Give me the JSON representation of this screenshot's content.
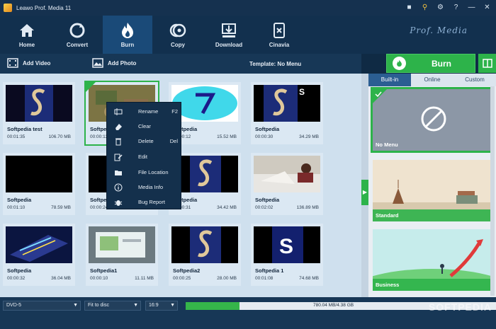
{
  "app": {
    "title": "Leawo Prof. Media 11",
    "brand": "Prof. Media",
    "title_icons": [
      "chat-icon",
      "key-icon",
      "gear-icon",
      "help-icon",
      "minimize-icon",
      "close-icon"
    ]
  },
  "nav": {
    "tabs": [
      {
        "label": "Home",
        "icon": "home-icon",
        "active": false
      },
      {
        "label": "Convert",
        "icon": "convert-icon",
        "active": false
      },
      {
        "label": "Burn",
        "icon": "flame-icon",
        "active": true
      },
      {
        "label": "Copy",
        "icon": "disc-copy-icon",
        "active": false
      },
      {
        "label": "Download",
        "icon": "download-icon",
        "active": false
      },
      {
        "label": "Cinavia",
        "icon": "cinavia-icon",
        "active": false
      }
    ]
  },
  "toolbar": {
    "add_video": "Add Video",
    "add_photo": "Add Photo",
    "template_label": "Template: No Menu",
    "burn_label": "Burn"
  },
  "videos": [
    {
      "name": "Softpedia test",
      "duration": "00:01:35",
      "size": "106.70 MB",
      "thumb": "softpedia-s"
    },
    {
      "name": "Softpedia",
      "duration": "00:00:13",
      "size": "",
      "thumb": "photo-ground",
      "selected": true
    },
    {
      "name": "Softpedia",
      "duration": "00:00:12",
      "size": "15.52 MB",
      "thumb": "number-7"
    },
    {
      "name": "Softpedia",
      "duration": "00:00:30",
      "size": "34.29 MB",
      "thumb": "softpedia-s"
    },
    {
      "name": "Softpedia",
      "duration": "00:01:10",
      "size": "78.59 MB",
      "thumb": "black"
    },
    {
      "name": "Softpedia",
      "duration": "00:00:24",
      "size": "",
      "thumb": "black"
    },
    {
      "name": "Softpedia",
      "duration": "00:00:31",
      "size": "34.42 MB",
      "thumb": "softpedia-s"
    },
    {
      "name": "Softpedia",
      "duration": "00:02:02",
      "size": "136.89 MB",
      "thumb": "photo-room"
    },
    {
      "name": "Softpedia",
      "duration": "00:00:32",
      "size": "36.04 MB",
      "thumb": "photo-device"
    },
    {
      "name": "Softpedia1",
      "duration": "00:00:10",
      "size": "11.11 MB",
      "thumb": "photo-screen"
    },
    {
      "name": "Softpedia2",
      "duration": "00:00:25",
      "size": "28.00 MB",
      "thumb": "softpedia-s"
    },
    {
      "name": "Softpedia 1",
      "duration": "00:01:08",
      "size": "74.68 MB",
      "thumb": "big-s"
    }
  ],
  "context_menu": [
    {
      "label": "Rename",
      "shortcut": "F2",
      "icon": "rename-icon"
    },
    {
      "label": "Clear",
      "shortcut": "",
      "icon": "eraser-icon"
    },
    {
      "label": "Delete",
      "shortcut": "Del",
      "icon": "trash-icon"
    },
    {
      "label": "Edit",
      "shortcut": "",
      "icon": "edit-icon"
    },
    {
      "label": "File Location",
      "shortcut": "",
      "icon": "folder-icon"
    },
    {
      "label": "Media Info",
      "shortcut": "",
      "icon": "info-icon"
    },
    {
      "label": "Bug Report",
      "shortcut": "",
      "icon": "bug-icon"
    }
  ],
  "template_panel": {
    "tabs": [
      "Built-in",
      "Online",
      "Custom"
    ],
    "active_tab": "Built-in",
    "templates": [
      {
        "label": "No Menu",
        "selected": true
      },
      {
        "label": "Standard",
        "selected": false
      },
      {
        "label": "Business",
        "selected": false
      }
    ]
  },
  "bottom": {
    "disc_type": "DVD-5",
    "fit": "Fit to disc",
    "aspect": "16:9",
    "usage_text": "780.04 MB/4.38 GB",
    "usage_fraction": 0.174,
    "watermark": "SOFTPEDIA"
  },
  "colors": {
    "accent_green": "#2db34a",
    "header_blue": "#12304e",
    "active_tab": "#1a4a78"
  }
}
